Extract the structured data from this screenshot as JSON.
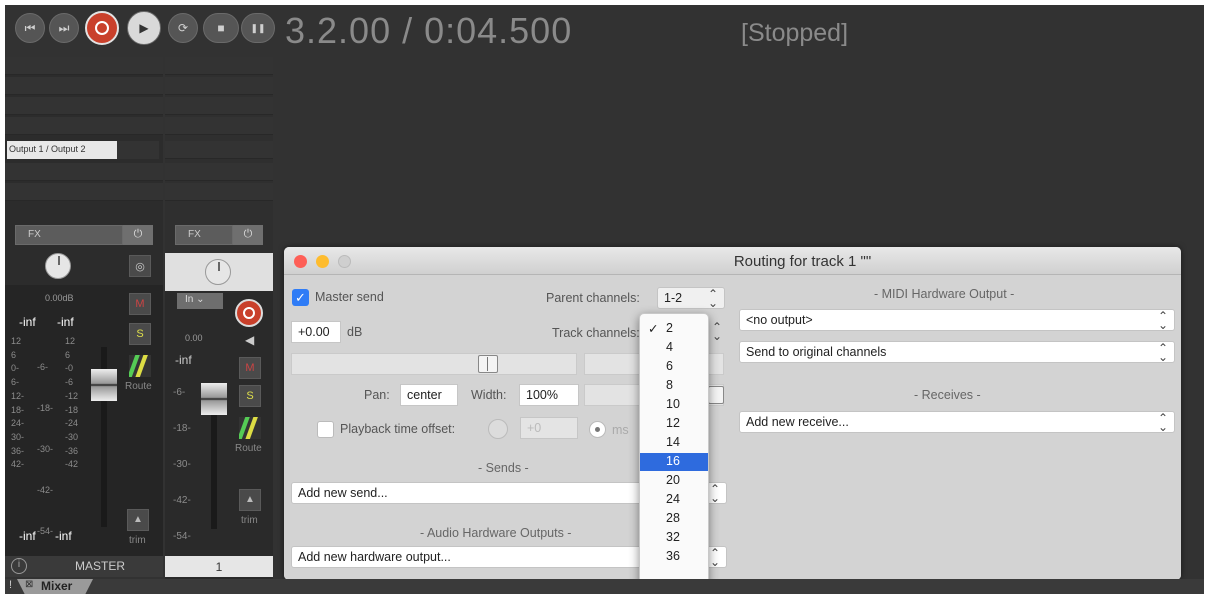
{
  "transport": {
    "buttons": [
      {
        "name": "go-to-start-button",
        "glyph": "⏮"
      },
      {
        "name": "go-to-end-button",
        "glyph": "⏭"
      },
      {
        "name": "record-button",
        "glyph": ""
      },
      {
        "name": "play-button",
        "glyph": "▶"
      },
      {
        "name": "repeat-button",
        "glyph": "⟳"
      },
      {
        "name": "stop-button",
        "glyph": "■"
      },
      {
        "name": "pause-button",
        "glyph": "❚❚"
      }
    ],
    "position": "3.2.00 / 0:04.500",
    "status": "[Stopped]"
  },
  "master": {
    "output": "Output 1 / Output 2",
    "fx": "FX",
    "power": "⏻",
    "stereo": "◎",
    "volume": "0.00dB",
    "peak_l": "-inf",
    "peak_r": "-inf",
    "mute": "M",
    "solo": "S",
    "route": "Route",
    "trim": "trim",
    "bottom_l": "-inf",
    "bottom_r": "-inf",
    "name": "MASTER",
    "info": "i",
    "scale_left": [
      "12",
      "6",
      "0-",
      "6-",
      "12-",
      "18-",
      "24-",
      "30-",
      "36-",
      "42-"
    ],
    "scale_mid": [
      "-6-",
      "-18-",
      "-30-",
      "-42-",
      "-54-"
    ],
    "scale_right": [
      "12",
      "6",
      "-0",
      "-6",
      "-12",
      "-18",
      "-24",
      "-30",
      "-36",
      "-42"
    ]
  },
  "track1": {
    "fx": "FX",
    "power": "⏻",
    "input": "In",
    "volume": "0.00",
    "peak": "-inf",
    "mute": "M",
    "solo": "S",
    "route": "Route",
    "trim": "trim",
    "number": "1",
    "scale": [
      "-6-",
      "-18-",
      "-30-",
      "-42-",
      "-54-"
    ]
  },
  "routing": {
    "title": "Routing for track 1 \"\"",
    "master_send_label": "Master send",
    "parent_channels_label": "Parent channels:",
    "parent_channels": "1-2",
    "volume": "+0.00",
    "db": "dB",
    "track_channels_label": "Track channels:",
    "pan_label": "Pan:",
    "pan": "center",
    "width_label": "Width:",
    "width": "100%",
    "playback_offset_label": "Playback time offset:",
    "offset_value": "+0",
    "ms": "ms",
    "sends_header": "- Sends -",
    "add_send": "Add new send...",
    "hw_header": "- Audio Hardware Outputs -",
    "add_hw": "Add new hardware output...",
    "midi_header": "- MIDI Hardware Output -",
    "midi_output": "<no output>",
    "midi_channels": "Send to original channels",
    "receives_header": "- Receives -",
    "add_receive": "Add new receive..."
  },
  "channel_menu": {
    "items": [
      "2",
      "4",
      "6",
      "8",
      "10",
      "12",
      "14",
      "16",
      "20",
      "24",
      "28",
      "32",
      "36"
    ],
    "checked": "2",
    "highlighted": "16",
    "more": "▼"
  },
  "tabs": {
    "mixer": "Mixer",
    "close": "⊠",
    "marker": "!"
  },
  "colors": {
    "record": "#c9402b",
    "selection": "#2e6bde",
    "check": "#2f7cf6"
  }
}
